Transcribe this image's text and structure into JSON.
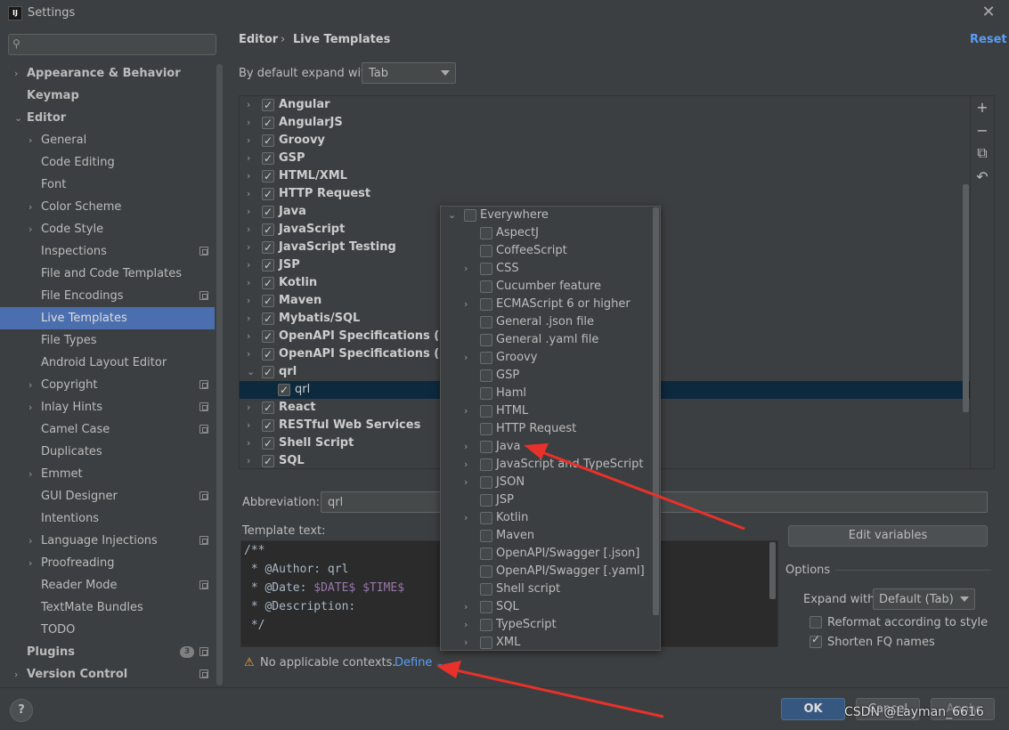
{
  "window": {
    "title": "Settings",
    "app_icon": "IJ"
  },
  "search": {
    "placeholder": ""
  },
  "sidebar": {
    "items": [
      {
        "label": "Appearance & Behavior",
        "level": 0,
        "bold": true,
        "chevron": "›"
      },
      {
        "label": "Keymap",
        "level": 0,
        "bold": true,
        "chevron": ""
      },
      {
        "label": "Editor",
        "level": 0,
        "bold": true,
        "chevron": "⌄"
      },
      {
        "label": "General",
        "level": 1,
        "chevron": "›"
      },
      {
        "label": "Code Editing",
        "level": 1,
        "chevron": ""
      },
      {
        "label": "Font",
        "level": 1,
        "chevron": ""
      },
      {
        "label": "Color Scheme",
        "level": 1,
        "chevron": "›"
      },
      {
        "label": "Code Style",
        "level": 1,
        "chevron": "›"
      },
      {
        "label": "Inspections",
        "level": 1,
        "chevron": "",
        "cfg": true
      },
      {
        "label": "File and Code Templates",
        "level": 1,
        "chevron": ""
      },
      {
        "label": "File Encodings",
        "level": 1,
        "chevron": "",
        "cfg": true
      },
      {
        "label": "Live Templates",
        "level": 1,
        "chevron": "",
        "selected": true
      },
      {
        "label": "File Types",
        "level": 1,
        "chevron": ""
      },
      {
        "label": "Android Layout Editor",
        "level": 1,
        "chevron": ""
      },
      {
        "label": "Copyright",
        "level": 1,
        "chevron": "›",
        "cfg": true
      },
      {
        "label": "Inlay Hints",
        "level": 1,
        "chevron": "›",
        "cfg": true
      },
      {
        "label": "Camel Case",
        "level": 1,
        "chevron": "",
        "cfg": true
      },
      {
        "label": "Duplicates",
        "level": 1,
        "chevron": ""
      },
      {
        "label": "Emmet",
        "level": 1,
        "chevron": "›"
      },
      {
        "label": "GUI Designer",
        "level": 1,
        "chevron": "",
        "cfg": true
      },
      {
        "label": "Intentions",
        "level": 1,
        "chevron": ""
      },
      {
        "label": "Language Injections",
        "level": 1,
        "chevron": "›",
        "cfg": true
      },
      {
        "label": "Proofreading",
        "level": 1,
        "chevron": "›"
      },
      {
        "label": "Reader Mode",
        "level": 1,
        "chevron": "",
        "cfg": true
      },
      {
        "label": "TextMate Bundles",
        "level": 1,
        "chevron": ""
      },
      {
        "label": "TODO",
        "level": 1,
        "chevron": ""
      },
      {
        "label": "Plugins",
        "level": 0,
        "bold": true,
        "chevron": "",
        "cfg": true,
        "badge": "3"
      },
      {
        "label": "Version Control",
        "level": 0,
        "bold": true,
        "chevron": "›",
        "cfg": true
      }
    ]
  },
  "header": {
    "crumb_parent": "Editor",
    "crumb_sep": "›",
    "crumb_current": "Live Templates",
    "reset": "Reset"
  },
  "expand_default": {
    "label": "By default expand with",
    "value": "Tab"
  },
  "template_groups": [
    {
      "label": "Angular",
      "checked": true,
      "expanded": false
    },
    {
      "label": "AngularJS",
      "checked": true,
      "expanded": false
    },
    {
      "label": "Groovy",
      "checked": true,
      "expanded": false
    },
    {
      "label": "GSP",
      "checked": true,
      "expanded": false
    },
    {
      "label": "HTML/XML",
      "checked": true,
      "expanded": false
    },
    {
      "label": "HTTP Request",
      "checked": true,
      "expanded": false
    },
    {
      "label": "Java",
      "checked": true,
      "expanded": false
    },
    {
      "label": "JavaScript",
      "checked": true,
      "expanded": false
    },
    {
      "label": "JavaScript Testing",
      "checked": true,
      "expanded": false
    },
    {
      "label": "JSP",
      "checked": true,
      "expanded": false
    },
    {
      "label": "Kotlin",
      "checked": true,
      "expanded": false
    },
    {
      "label": "Maven",
      "checked": true,
      "expanded": false
    },
    {
      "label": "Mybatis/SQL",
      "checked": true,
      "expanded": false
    },
    {
      "label": "OpenAPI Specifications (.json)",
      "checked": true,
      "expanded": false
    },
    {
      "label": "OpenAPI Specifications (.yaml)",
      "checked": true,
      "expanded": false
    },
    {
      "label": "qrl",
      "checked": true,
      "expanded": true
    },
    {
      "label": "qrl",
      "checked": true,
      "child": true,
      "selected": true
    },
    {
      "label": "React",
      "checked": true,
      "expanded": false
    },
    {
      "label": "RESTful Web Services",
      "checked": true,
      "expanded": false
    },
    {
      "label": "Shell Script",
      "checked": true,
      "expanded": false
    },
    {
      "label": "SQL",
      "checked": true,
      "expanded": false
    }
  ],
  "toolbar": {
    "add": "+",
    "remove": "−",
    "copy": "⧉",
    "restore": "↶"
  },
  "abbreviation": {
    "label": "Abbreviation:",
    "value": "qrl"
  },
  "template_text": {
    "label": "Template text:",
    "lines": [
      "/**",
      " * @Author: qrl",
      " * @Date: ",
      " * @Description:",
      " */"
    ],
    "date_vars": "$DATE$ $TIME$"
  },
  "contexts": {
    "warning": "No applicable contexts.",
    "define": "Define"
  },
  "options": {
    "edit_variables": "Edit variables",
    "section": "Options",
    "expand_with_label": "Expand with",
    "expand_with_value": "Default (Tab)",
    "reformat": {
      "label": "Reformat according to style",
      "checked": false
    },
    "shorten": {
      "label": "Shorten FQ names",
      "checked": true
    }
  },
  "context_popup": [
    {
      "label": "Everywhere",
      "chevron": "⌄",
      "level": 0
    },
    {
      "label": "AspectJ",
      "chevron": "",
      "level": 1
    },
    {
      "label": "CoffeeScript",
      "chevron": "",
      "level": 1
    },
    {
      "label": "CSS",
      "chevron": "›",
      "level": 1
    },
    {
      "label": "Cucumber feature",
      "chevron": "",
      "level": 1
    },
    {
      "label": "ECMAScript 6 or higher",
      "chevron": "›",
      "level": 1
    },
    {
      "label": "General .json file",
      "chevron": "",
      "level": 1
    },
    {
      "label": "General .yaml file",
      "chevron": "",
      "level": 1
    },
    {
      "label": "Groovy",
      "chevron": "›",
      "level": 1
    },
    {
      "label": "GSP",
      "chevron": "",
      "level": 1
    },
    {
      "label": "Haml",
      "chevron": "",
      "level": 1
    },
    {
      "label": "HTML",
      "chevron": "›",
      "level": 1
    },
    {
      "label": "HTTP Request",
      "chevron": "",
      "level": 1
    },
    {
      "label": "Java",
      "chevron": "›",
      "level": 1
    },
    {
      "label": "JavaScript and TypeScript",
      "chevron": "›",
      "level": 1
    },
    {
      "label": "JSON",
      "chevron": "›",
      "level": 1
    },
    {
      "label": "JSP",
      "chevron": "",
      "level": 1
    },
    {
      "label": "Kotlin",
      "chevron": "›",
      "level": 1
    },
    {
      "label": "Maven",
      "chevron": "",
      "level": 1
    },
    {
      "label": "OpenAPI/Swagger [.json]",
      "chevron": "",
      "level": 1
    },
    {
      "label": "OpenAPI/Swagger [.yaml]",
      "chevron": "",
      "level": 1
    },
    {
      "label": "Shell script",
      "chevron": "",
      "level": 1
    },
    {
      "label": "SQL",
      "chevron": "›",
      "level": 1
    },
    {
      "label": "TypeScript",
      "chevron": "›",
      "level": 1
    },
    {
      "label": "XML",
      "chevron": "›",
      "level": 1
    }
  ],
  "buttons": {
    "help": "?",
    "ok": "OK",
    "cancel": "Cancel",
    "apply": "Apply"
  },
  "watermark": "CSDN @Layman_6616",
  "colors": {
    "accent": "#4b6eaf",
    "link": "#589df6",
    "annotation_arrow": "#e8312a"
  }
}
